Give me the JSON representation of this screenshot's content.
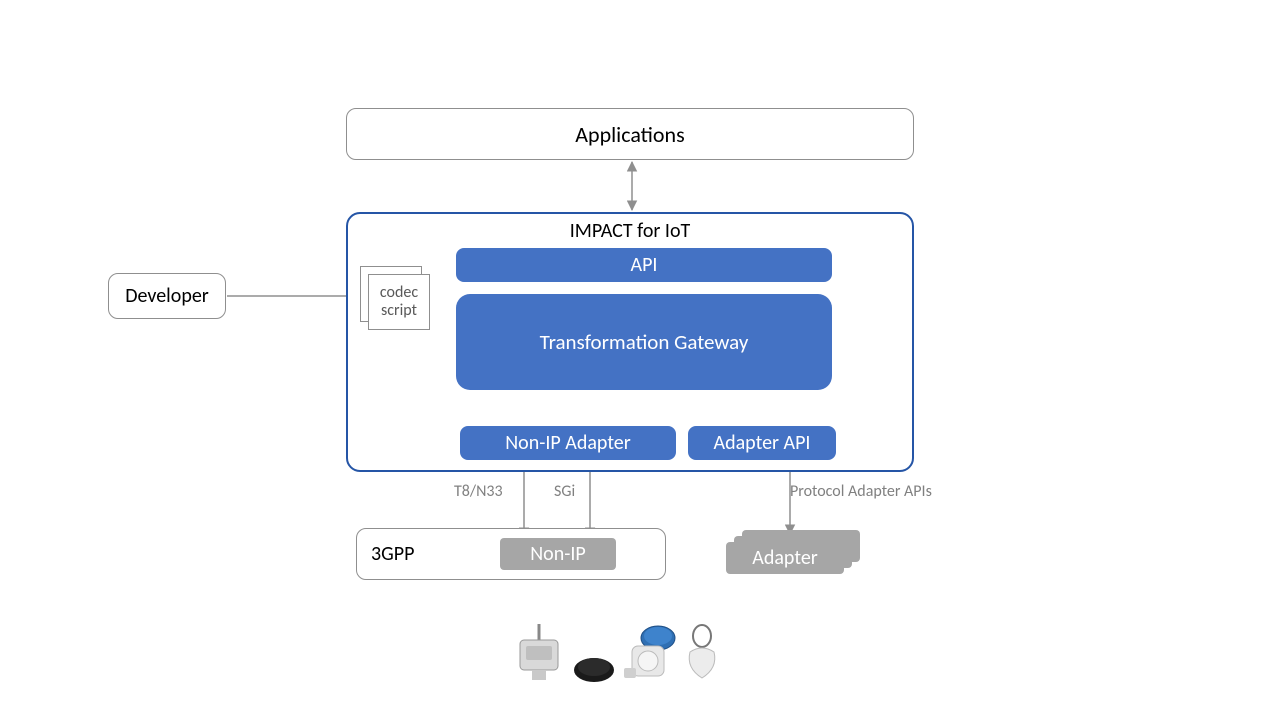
{
  "applications": {
    "label": "Applications"
  },
  "developer": {
    "label": "Developer"
  },
  "impact": {
    "title": "IMPACT for IoT",
    "api": "API",
    "transformation_gateway": "Transformation Gateway",
    "non_ip_adapter": "Non-IP Adapter",
    "adapter_api": "Adapter API"
  },
  "codec": {
    "line1": "codec",
    "line2": "script"
  },
  "labels": {
    "t8_n33": "T8/N33",
    "sgi": "SGi",
    "protocol_adapter_apis": "Protocol Adapter APIs"
  },
  "gpp": {
    "title": "3GPP",
    "non_ip": "Non-IP"
  },
  "adapter_stack": {
    "label": "Adapter"
  },
  "colors": {
    "accent_blue": "#4472c4",
    "border_blue": "#2555a6",
    "gray_fill": "#a6a6a6",
    "border_gray": "#8f8f8f",
    "label_gray": "#808080"
  }
}
